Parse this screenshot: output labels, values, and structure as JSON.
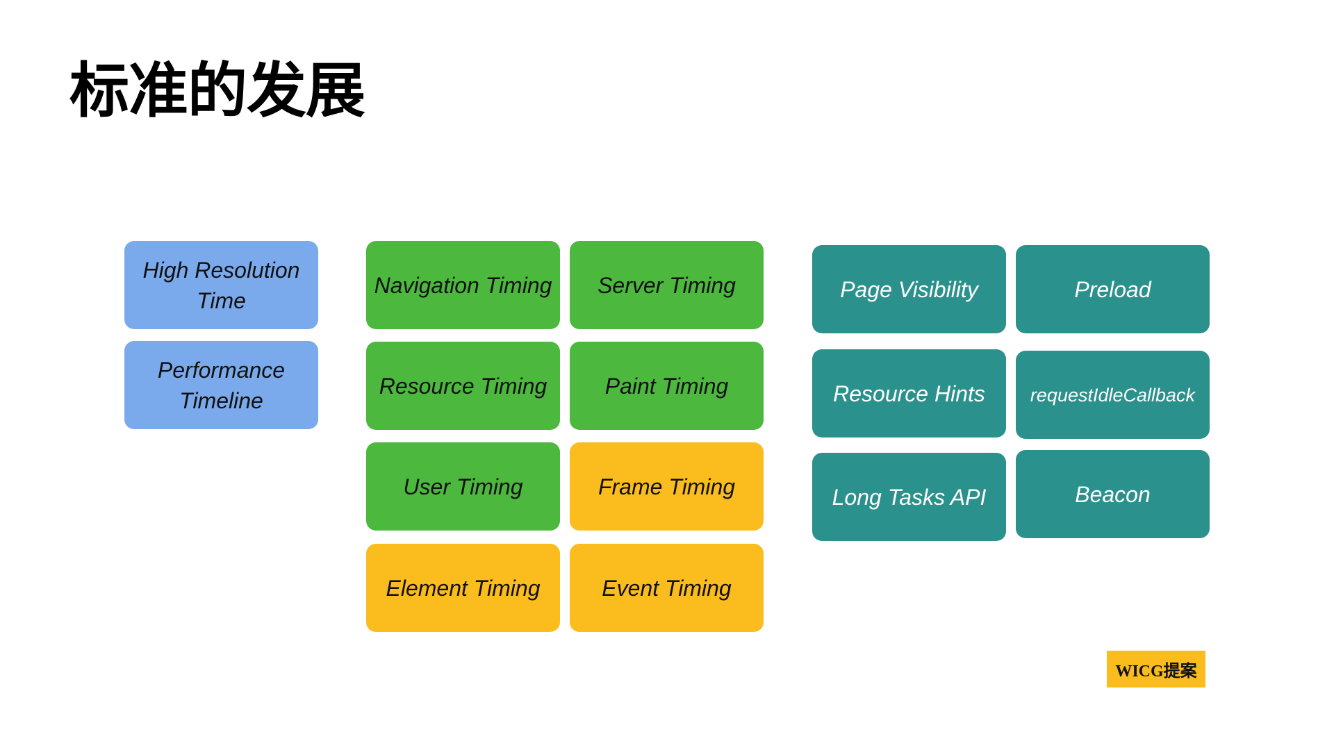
{
  "slide": {
    "title": "标准的发展"
  },
  "groups": {
    "foundation": {
      "color": "#7BAAEC",
      "items": [
        "High Resolution Time",
        "Performance Timeline"
      ]
    },
    "timing": {
      "items": [
        {
          "label": "Navigation Timing",
          "color": "#4CB83E"
        },
        {
          "label": "Server Timing",
          "color": "#4CB83E"
        },
        {
          "label": "Resource Timing",
          "color": "#4CB83E"
        },
        {
          "label": "Paint Timing",
          "color": "#4CB83E"
        },
        {
          "label": "User Timing",
          "color": "#4CB83E"
        },
        {
          "label": "Frame Timing",
          "color": "#FBBC1E"
        },
        {
          "label": "Element Timing",
          "color": "#FBBC1E"
        },
        {
          "label": "Event Timing",
          "color": "#FBBC1E"
        }
      ]
    },
    "related": {
      "color": "#2B918C",
      "items": [
        "Page Visibility",
        "Preload",
        "Resource Hints",
        "requestIdleCallback",
        "Long Tasks API",
        "Beacon"
      ]
    }
  },
  "legend": {
    "label": "WICG提案",
    "color": "#FBBC1E"
  }
}
